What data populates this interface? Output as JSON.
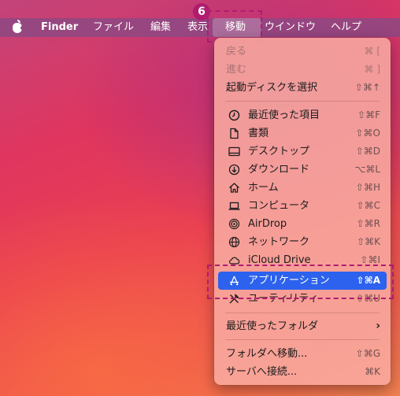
{
  "callout_number": "6",
  "menubar": {
    "app_name": "Finder",
    "items": [
      "ファイル",
      "編集",
      "表示",
      "移動",
      "ウインドウ",
      "ヘルプ"
    ]
  },
  "go_menu": {
    "items": [
      {
        "label": "戻る",
        "shortcut": "⌘ [",
        "icon": "",
        "disabled": true
      },
      {
        "label": "進む",
        "shortcut": "⌘ ]",
        "icon": "",
        "disabled": true
      },
      {
        "label": "起動ディスクを選択",
        "shortcut": "⇧⌘↑",
        "icon": ""
      },
      {
        "label": "最近使った項目",
        "shortcut": "⇧⌘F",
        "icon": "clock-icon"
      },
      {
        "label": "書類",
        "shortcut": "⇧⌘O",
        "icon": "document-icon"
      },
      {
        "label": "デスクトップ",
        "shortcut": "⇧⌘D",
        "icon": "desktop-icon"
      },
      {
        "label": "ダウンロード",
        "shortcut": "⌥⌘L",
        "icon": "download-icon"
      },
      {
        "label": "ホーム",
        "shortcut": "⇧⌘H",
        "icon": "home-icon"
      },
      {
        "label": "コンピュータ",
        "shortcut": "⇧⌘C",
        "icon": "laptop-icon"
      },
      {
        "label": "AirDrop",
        "shortcut": "⇧⌘R",
        "icon": "airdrop-icon"
      },
      {
        "label": "ネットワーク",
        "shortcut": "⇧⌘K",
        "icon": "globe-icon"
      },
      {
        "label": "iCloud Drive",
        "shortcut": "⇧⌘I",
        "icon": "cloud-icon"
      },
      {
        "label": "アプリケーション",
        "shortcut": "⇧⌘A",
        "icon": "applications-icon",
        "highlighted": true
      },
      {
        "label": "ユーティリティ",
        "shortcut": "⇧⌘U",
        "icon": "tools-icon"
      },
      {
        "label": "最近使ったフォルダ",
        "shortcut": "",
        "icon": "",
        "submenu": true
      },
      {
        "label": "フォルダへ移動...",
        "shortcut": "⇧⌘G",
        "icon": ""
      },
      {
        "label": "サーバへ接続...",
        "shortcut": "⌘K",
        "icon": ""
      }
    ]
  },
  "colors": {
    "highlight": "#2c62ed",
    "callout": "#b01c6e"
  }
}
